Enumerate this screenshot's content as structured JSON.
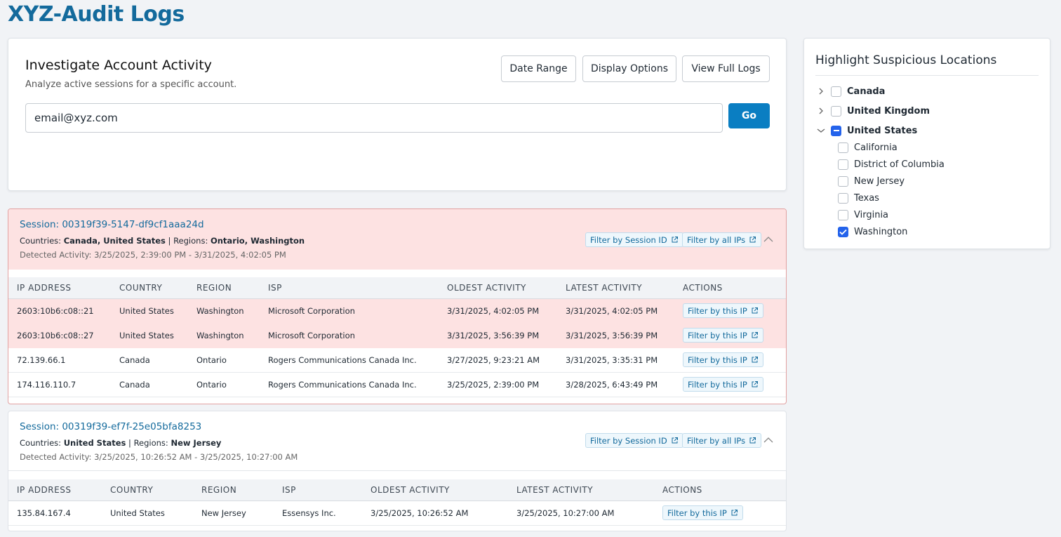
{
  "page": {
    "title": "XYZ-Audit Logs"
  },
  "investigate": {
    "title": "Investigate Account Activity",
    "subtitle": "Analyze active sessions for a specific account.",
    "buttons": {
      "date_range": "Date Range",
      "display_options": "Display Options",
      "view_full_logs": "View Full Logs"
    },
    "email_value": "email@xyz.com",
    "go_label": "Go"
  },
  "locations": {
    "title": "Highlight Suspicious Locations",
    "countries": [
      {
        "label": "Canada",
        "expanded": false,
        "state": "unchecked"
      },
      {
        "label": "United Kingdom",
        "expanded": false,
        "state": "unchecked"
      },
      {
        "label": "United States",
        "expanded": true,
        "state": "indeterminate"
      }
    ],
    "us_regions": [
      {
        "label": "California",
        "checked": false
      },
      {
        "label": "District of Columbia",
        "checked": false
      },
      {
        "label": "New Jersey",
        "checked": false
      },
      {
        "label": "Texas",
        "checked": false
      },
      {
        "label": "Virginia",
        "checked": false
      },
      {
        "label": "Washington",
        "checked": true
      }
    ]
  },
  "table_headers": [
    "IP ADDRESS",
    "COUNTRY",
    "REGION",
    "ISP",
    "OLDEST ACTIVITY",
    "LATEST ACTIVITY",
    "ACTIONS"
  ],
  "filter_session_label": "Filter by Session ID",
  "filter_all_ips_label": "Filter by all IPs",
  "filter_ip_label": "Filter by this IP",
  "labels": {
    "countries": "Countries:",
    "regions": "Regions:",
    "separator": "|"
  },
  "sessions": [
    {
      "id": "Session: 00319f39-5147-df9cf1aaa24d",
      "countries": "Canada, United States",
      "regions": "Ontario, Washington",
      "detected": "Detected Activity: 3/25/2025, 2:39:00 PM - 3/31/2025, 4:02:05 PM",
      "rows": [
        {
          "ip": "2603:10b6:c08::21",
          "country": "United States",
          "region": "Washington",
          "isp": "Microsoft Corporation",
          "oldest": "3/31/2025, 4:02:05 PM",
          "latest": "3/31/2025, 4:02:05 PM",
          "highlighted": true
        },
        {
          "ip": "2603:10b6:c08::27",
          "country": "United States",
          "region": "Washington",
          "isp": "Microsoft Corporation",
          "oldest": "3/31/2025, 3:56:39 PM",
          "latest": "3/31/2025, 3:56:39 PM",
          "highlighted": true
        },
        {
          "ip": "72.139.66.1",
          "country": "Canada",
          "region": "Ontario",
          "isp": "Rogers Communications Canada Inc.",
          "oldest": "3/27/2025, 9:23:21 AM",
          "latest": "3/31/2025, 3:35:31 PM",
          "highlighted": false
        },
        {
          "ip": "174.116.110.7",
          "country": "Canada",
          "region": "Ontario",
          "isp": "Rogers Communications Canada Inc.",
          "oldest": "3/25/2025, 2:39:00 PM",
          "latest": "3/28/2025, 6:43:49 PM",
          "highlighted": false
        }
      ]
    },
    {
      "id": "Session: 00319f39-ef7f-25e05bfa8253",
      "countries": "United States",
      "regions": "New Jersey",
      "detected": "Detected Activity: 3/25/2025, 10:26:52 AM - 3/25/2025, 10:27:00 AM",
      "rows": [
        {
          "ip": "135.84.167.4",
          "country": "United States",
          "region": "New Jersey",
          "isp": "Essensys Inc.",
          "oldest": "3/25/2025, 10:26:52 AM",
          "latest": "3/25/2025, 10:27:00 AM",
          "highlighted": false
        }
      ]
    }
  ],
  "colors": {
    "accent": "#136a9c",
    "primary_button": "#0a7ec2",
    "alert_bg": "#fde2e2",
    "checkbox": "#2463eb"
  }
}
